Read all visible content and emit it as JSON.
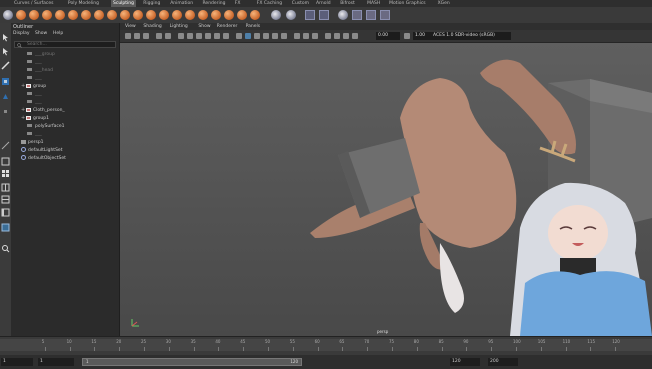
{
  "shelf_tabs": [
    "Curves / Surfaces",
    "Poly Modeling",
    "Sculpting",
    "Rigging",
    "Animation",
    "Rendering",
    "FX",
    "FX Caching",
    "Custom",
    "Arnold",
    "Bifrost",
    "MASH",
    "Motion Graphics",
    "XGen"
  ],
  "active_shelf_tab": "Sculpting",
  "outliner": {
    "title": "Outliner",
    "menu": [
      "Display",
      "Show",
      "Help"
    ],
    "search_placeholder": "Search...",
    "items": [
      {
        "label": "___group",
        "dim": true,
        "icon": "mesh"
      },
      {
        "label": "___",
        "dim": true,
        "icon": "mesh"
      },
      {
        "label": "___head",
        "dim": true,
        "icon": "mesh"
      },
      {
        "label": "___",
        "dim": true,
        "icon": "mesh"
      },
      {
        "label": "group",
        "dim": false,
        "icon": "group"
      },
      {
        "label": "___",
        "dim": true,
        "icon": "mesh"
      },
      {
        "label": "___",
        "dim": true,
        "icon": "mesh"
      },
      {
        "label": "Cloth_person_",
        "dim": false,
        "icon": "group"
      },
      {
        "label": "group1",
        "dim": false,
        "icon": "group"
      },
      {
        "label": "polySurface1",
        "dim": false,
        "icon": "mesh"
      },
      {
        "label": "___",
        "dim": true,
        "icon": "mesh"
      },
      {
        "label": "persp1",
        "dim": false,
        "icon": "camera"
      },
      {
        "label": "defaultLightSet",
        "dim": false,
        "icon": "set"
      },
      {
        "label": "defaultObjectSet",
        "dim": false,
        "icon": "set"
      }
    ]
  },
  "viewport": {
    "menu": [
      "View",
      "Shading",
      "Lighting",
      "Show",
      "Renderer",
      "Panels"
    ],
    "exposure": "0.00",
    "gamma": "1.00",
    "color_space": "ACES 1.0 SDR-video (sRGB)",
    "camera_label": "persp"
  },
  "timeline": {
    "ticks": [
      "5",
      "10",
      "15",
      "20",
      "25",
      "30",
      "35",
      "40",
      "45",
      "50",
      "55",
      "60",
      "65",
      "70",
      "75",
      "80",
      "85",
      "90",
      "95",
      "100",
      "105",
      "110",
      "115",
      "120"
    ]
  },
  "range": {
    "start": "1",
    "playback_start": "1",
    "playback_end": "120",
    "end": "120",
    "max_end": "200"
  },
  "colors": {
    "skin": "#b48a76",
    "sleeve": "#6e6e6e",
    "bg": "#444444"
  }
}
